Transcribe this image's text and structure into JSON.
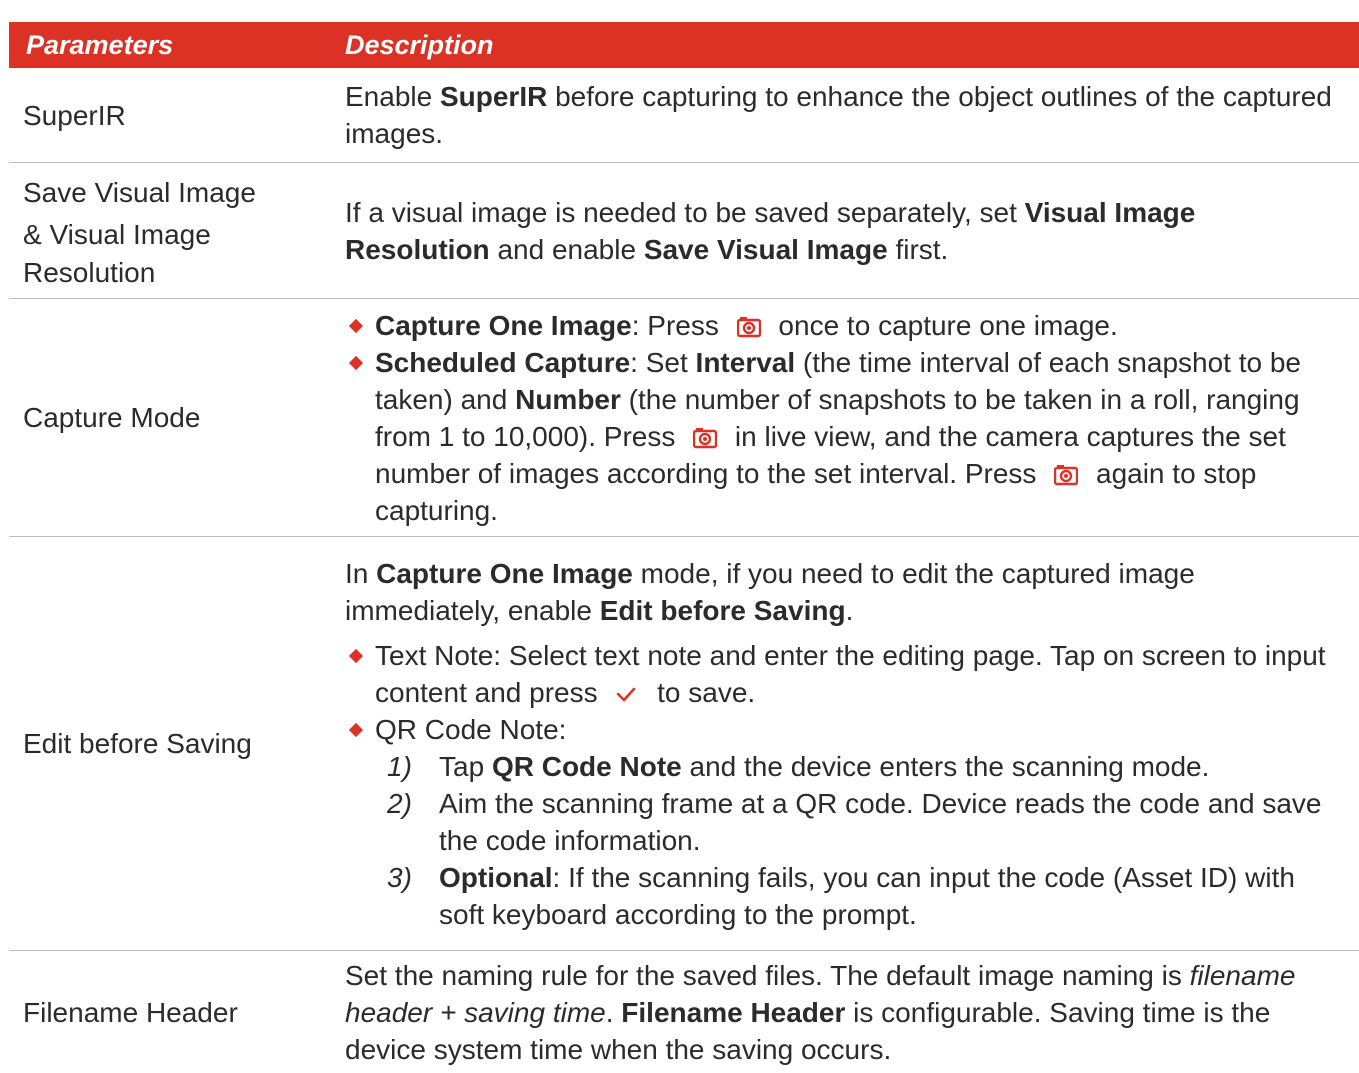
{
  "header": {
    "col1": "Parameters",
    "col2": "Description"
  },
  "colors": {
    "accent": "#dc3125",
    "divider": "#bdbdbd",
    "text": "#2b2b2b"
  },
  "icons": {
    "capture": "camera-capture-icon",
    "save": "checkmark-icon"
  },
  "rows": [
    {
      "param": "SuperIR",
      "desc": {
        "a": "Enable ",
        "b": "SuperIR",
        "c": " before capturing to enhance the object outlines of the captured images."
      }
    },
    {
      "param_line1": "Save Visual Image",
      "param_line2": "& Visual Image Resolution",
      "desc": {
        "a": "If a visual image is needed to be saved separately, set ",
        "b": "Visual Image Resolution",
        "c": " and enable ",
        "d": "Save Visual Image",
        "e": " first."
      }
    },
    {
      "param": "Capture Mode",
      "bullet1": {
        "b": "Capture One Image",
        "a": ": Press ",
        "c": " once to capture one image."
      },
      "bullet2": {
        "b1": "Scheduled Capture",
        "a1": ": Set ",
        "b2": "Interval",
        "a2": " (the time interval of each snapshot to be taken) and ",
        "b3": "Number",
        "a3": " (the number of snapshots to be taken in a roll, ranging from 1 to 10,000). Press ",
        "a4": " in live view, and the camera captures the set number of images according to the set interval. Press ",
        "a5": " again to stop capturing."
      }
    },
    {
      "param": "Edit before Saving",
      "intro": {
        "a": "In ",
        "b1": "Capture One Image",
        "c": " mode, if you need to edit the captured image immediately, enable ",
        "b2": "Edit before Saving",
        "d": "."
      },
      "bullet1": {
        "a": "Text Note: Select text note and enter the editing page. Tap on screen to input content and press ",
        "b": " to save."
      },
      "bullet2": "QR Code Note:",
      "steps": [
        {
          "num": "1)",
          "a": "Tap ",
          "b": "QR Code Note",
          "c": " and the device enters the scanning mode."
        },
        {
          "num": "2)",
          "a": "Aim the scanning frame at a QR code. Device reads the code and save the code information."
        },
        {
          "num": "3)",
          "b": "Optional",
          "a": ": If the scanning fails, you can input the code (Asset ID) with soft keyboard according to the prompt."
        }
      ]
    },
    {
      "param": "Filename Header",
      "desc": {
        "a": "Set the naming rule for the saved files. The default image naming is ",
        "i": "filename header + saving time",
        "b": ". ",
        "bold": "Filename Header",
        "c": " is configurable. Saving time is the device system time when the saving occurs."
      }
    }
  ]
}
